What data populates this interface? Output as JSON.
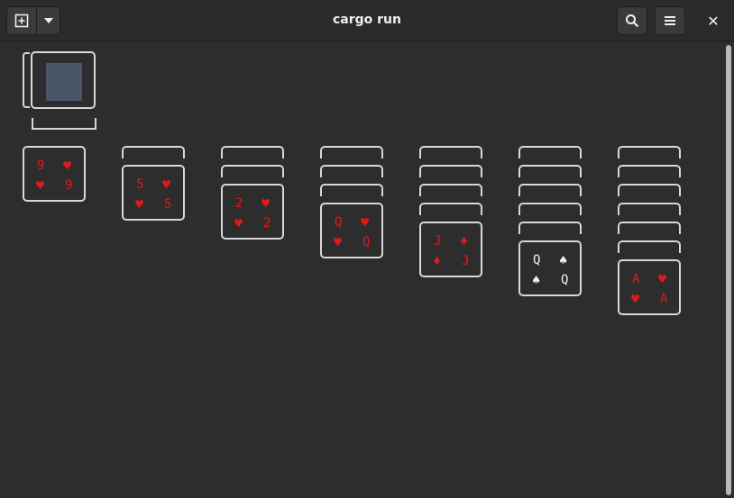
{
  "window": {
    "title": "cargo run"
  },
  "header": {
    "close_glyph": "✕"
  },
  "tableau": [
    {
      "hidden": 0,
      "top": {
        "rank": "9",
        "suit": "♥",
        "color": "red"
      }
    },
    {
      "hidden": 1,
      "top": {
        "rank": "5",
        "suit": "♥",
        "color": "red"
      }
    },
    {
      "hidden": 2,
      "top": {
        "rank": "2",
        "suit": "♥",
        "color": "red"
      }
    },
    {
      "hidden": 3,
      "top": {
        "rank": "Q",
        "suit": "♥",
        "color": "red"
      }
    },
    {
      "hidden": 4,
      "top": {
        "rank": "J",
        "suit": "♦",
        "color": "red"
      }
    },
    {
      "hidden": 5,
      "top": {
        "rank": "Q",
        "suit": "♠",
        "color": "white"
      }
    },
    {
      "hidden": 6,
      "top": {
        "rank": "A",
        "suit": "♥",
        "color": "red"
      }
    }
  ],
  "colors": {
    "red_suit": "#e0191d",
    "card_border": "#d8d8d8",
    "stock_back": "#4a5568"
  }
}
